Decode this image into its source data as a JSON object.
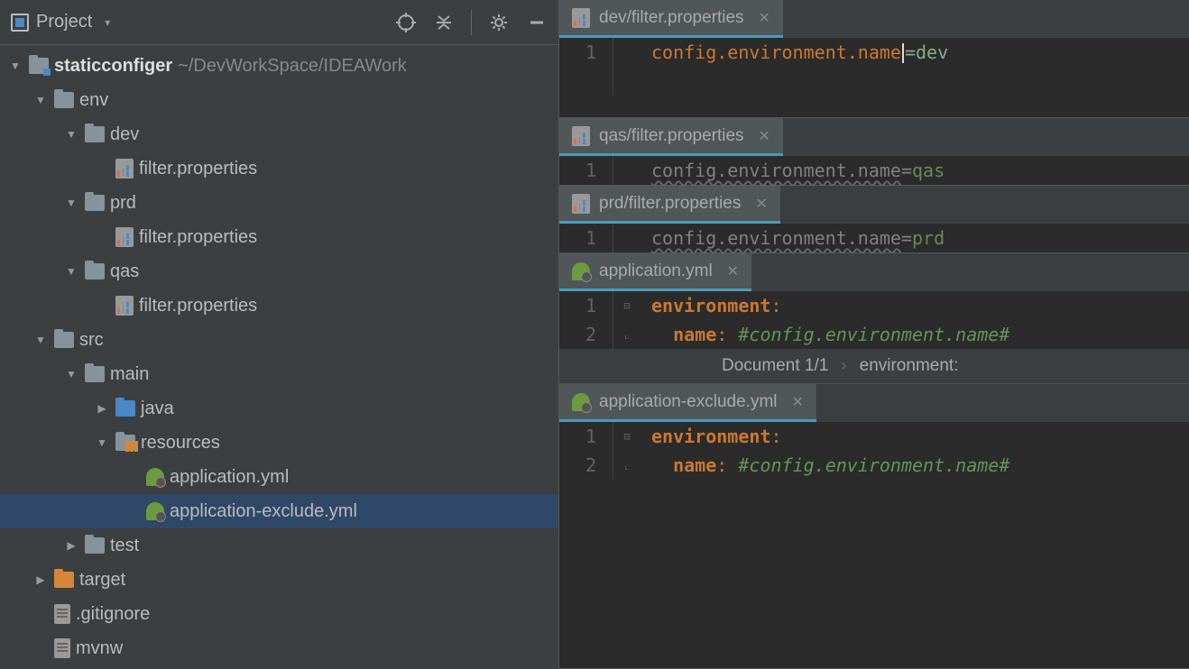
{
  "sidebar": {
    "title": "Project",
    "root_name": "staticconfiger",
    "root_path": "~/DevWorkSpace/IDEAWork",
    "tree": {
      "env": "env",
      "dev": "dev",
      "prd": "prd",
      "qas": "qas",
      "filter_props": "filter.properties",
      "src": "src",
      "main": "main",
      "java": "java",
      "resources": "resources",
      "app_yml": "application.yml",
      "app_excl_yml": "application-exclude.yml",
      "test": "test",
      "target": "target",
      "gitignore": ".gitignore",
      "mvnw": "mvnw"
    }
  },
  "editors": {
    "dev": {
      "tab": "dev/filter.properties",
      "line1_num": "1",
      "key": "config.environment.name",
      "eq": "=",
      "val": "dev"
    },
    "qas": {
      "tab": "qas/filter.properties",
      "line1_num": "1",
      "key": "config.environment.name",
      "eq": "=",
      "val": "qas"
    },
    "prd": {
      "tab": "prd/filter.properties",
      "line1_num": "1",
      "key": "config.environment.name",
      "eq": "=",
      "val": "prd"
    },
    "app": {
      "tab": "application.yml",
      "l1_num": "1",
      "l2_num": "2",
      "l1_key": "environment",
      "l2_key": "name",
      "colon": ":",
      "comment": "#config.environment.name#",
      "bc_doc": "Document 1/1",
      "bc_env": "environment:"
    },
    "app_excl": {
      "tab": "application-exclude.yml",
      "l1_num": "1",
      "l2_num": "2",
      "l1_key": "environment",
      "l2_key": "name",
      "colon": ":",
      "comment": "#config.environment.name#"
    }
  }
}
